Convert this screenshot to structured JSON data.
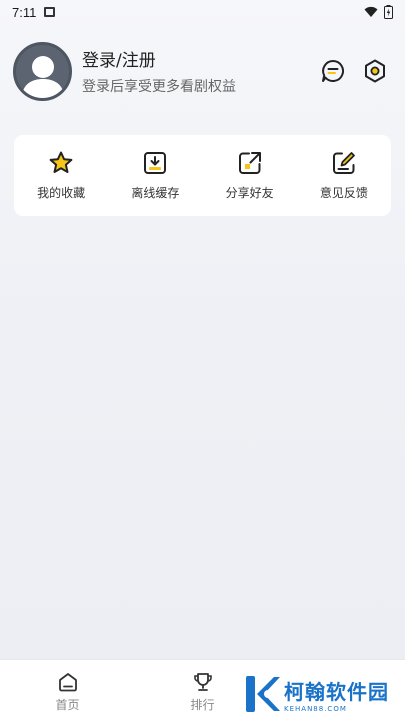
{
  "status_bar": {
    "time": "7:11",
    "icons": [
      "gallery-icon",
      "wifi-icon",
      "battery-icon"
    ]
  },
  "profile": {
    "title": "登录/注册",
    "subtitle": "登录后享受更多看剧权益",
    "top_icons": [
      "message-icon",
      "settings-icon"
    ]
  },
  "quick_actions": [
    {
      "label": "我的收藏",
      "icon": "star-icon"
    },
    {
      "label": "离线缓存",
      "icon": "download-icon"
    },
    {
      "label": "分享好友",
      "icon": "share-icon"
    },
    {
      "label": "意见反馈",
      "icon": "feedback-icon"
    }
  ],
  "bottom_nav": [
    {
      "label": "首页",
      "icon": "home-icon"
    },
    {
      "label": "排行",
      "icon": "trophy-icon"
    }
  ],
  "watermark": {
    "main": "柯翰软件园",
    "sub": "KEHAN88.COM"
  },
  "colors": {
    "accent": "#f5c518",
    "icon_stroke": "#333333",
    "watermark": "#1a73c8"
  }
}
